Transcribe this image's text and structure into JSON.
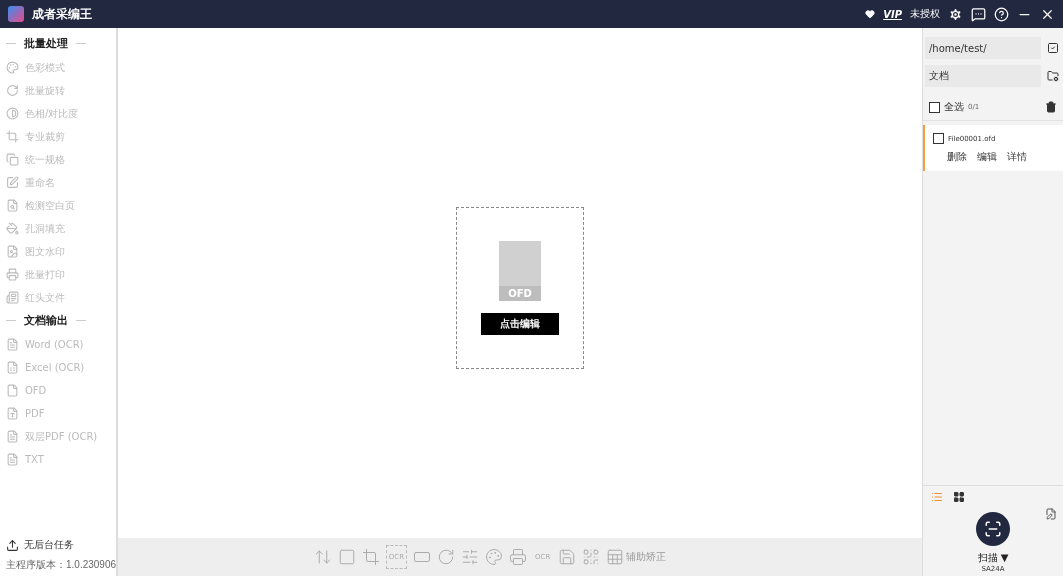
{
  "window": {
    "title": "成者采编王",
    "vip": "VIP",
    "license": "未授权"
  },
  "sidebar": {
    "sections": [
      {
        "title": "批量处理",
        "items": [
          {
            "label": "色彩模式",
            "disabled": true
          },
          {
            "label": "批量旋转",
            "disabled": true
          },
          {
            "label": "色相/对比度",
            "disabled": true
          },
          {
            "label": "专业裁剪",
            "disabled": true
          },
          {
            "label": "统一规格",
            "disabled": true
          },
          {
            "label": "重命名",
            "disabled": true
          },
          {
            "label": "检测空白页",
            "disabled": true
          },
          {
            "label": "孔洞填充",
            "disabled": true
          },
          {
            "label": "图文水印",
            "disabled": true
          },
          {
            "label": "批量打印",
            "disabled": true
          },
          {
            "label": "红头文件",
            "disabled": true
          }
        ]
      },
      {
        "title": "文档输出",
        "items": [
          {
            "label": "Word (OCR)",
            "disabled": true
          },
          {
            "label": "Excel (OCR)",
            "disabled": true
          },
          {
            "label": "OFD",
            "disabled": true
          },
          {
            "label": "PDF",
            "disabled": true
          },
          {
            "label": "双层PDF (OCR)",
            "disabled": true
          },
          {
            "label": "TXT",
            "disabled": true
          }
        ]
      }
    ],
    "tasks": "无后台任务",
    "version": "主程序版本：1.0.230906"
  },
  "canvas": {
    "file_badge": "OFD",
    "button": "点击编辑"
  },
  "toolbar": [
    {
      "kind": "height"
    },
    {
      "kind": "dashed"
    },
    {
      "kind": "crop"
    },
    {
      "kind": "ocr-dashed",
      "text": "OCR"
    },
    {
      "kind": "dashed-lines"
    },
    {
      "kind": "rotate"
    },
    {
      "kind": "sliders"
    },
    {
      "kind": "color"
    },
    {
      "kind": "print"
    },
    {
      "kind": "ocr",
      "text": "OCR"
    },
    {
      "kind": "save"
    },
    {
      "kind": "qr"
    },
    {
      "kind": "correct",
      "text": "辅助矫正"
    }
  ],
  "right_panel": {
    "path": "/home/test/",
    "folder": "文档",
    "select_all": {
      "label": "全选",
      "checked": false,
      "count": "0/1"
    },
    "files": [
      {
        "name": "File00001.ofd",
        "checked": false,
        "selected": true,
        "actions": [
          "删除",
          "编辑",
          "详情"
        ]
      }
    ],
    "views": [
      {
        "kind": "list",
        "selected": true
      },
      {
        "kind": "grid",
        "selected": false
      }
    ],
    "scan": {
      "label": "扫描 ▼",
      "device": "SA24A"
    }
  }
}
